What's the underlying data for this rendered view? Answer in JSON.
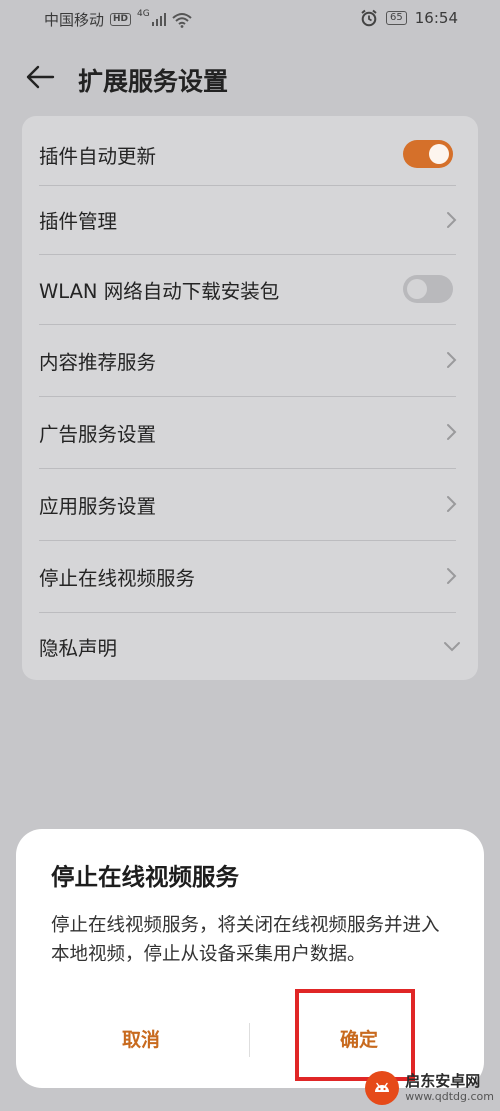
{
  "status_bar": {
    "carrier": "中国移动",
    "hd": "HD",
    "net": "4G",
    "battery": "65",
    "time": "16:54"
  },
  "header": {
    "title": "扩展服务设置"
  },
  "settings": {
    "items": [
      {
        "label": "插件自动更新",
        "control": "toggle",
        "on": true
      },
      {
        "label": "插件管理",
        "control": "chevron"
      },
      {
        "label": "WLAN 网络自动下载安装包",
        "control": "toggle",
        "on": false
      },
      {
        "label": "内容推荐服务",
        "control": "chevron"
      },
      {
        "label": "广告服务设置",
        "control": "chevron"
      },
      {
        "label": "应用服务设置",
        "control": "chevron"
      },
      {
        "label": "停止在线视频服务",
        "control": "chevron"
      },
      {
        "label": "隐私声明",
        "control": "expand"
      }
    ]
  },
  "dialog": {
    "title": "停止在线视频服务",
    "message": "停止在线视频服务，将关闭在线视频服务并进入本地视频，停止从设备采集用户数据。",
    "cancel_label": "取消",
    "confirm_label": "确定"
  },
  "watermark": {
    "name": "启东安卓网",
    "url": "www.qdtdg.com"
  },
  "colors": {
    "accent": "#d5702a",
    "dialog_button": "#c86a1e",
    "highlight": "#e02626"
  }
}
